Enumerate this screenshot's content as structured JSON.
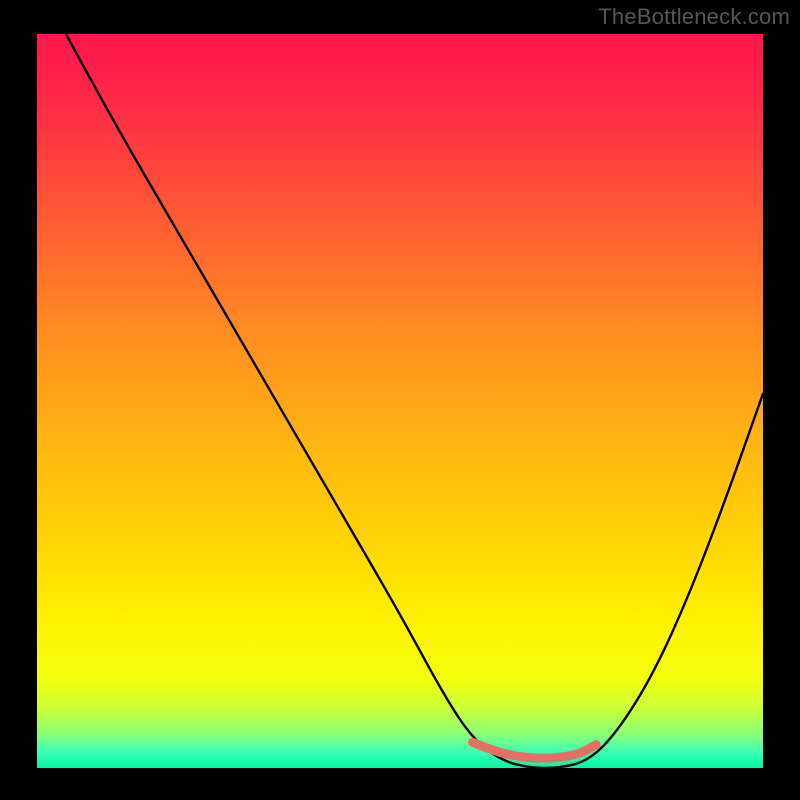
{
  "watermark": "TheBottleneck.com",
  "colors": {
    "black": "#000000",
    "gradient_stops": [
      {
        "offset": 0.0,
        "color": "#ff154e"
      },
      {
        "offset": 0.1,
        "color": "#ff2b46"
      },
      {
        "offset": 0.25,
        "color": "#ff5a34"
      },
      {
        "offset": 0.4,
        "color": "#ff8b22"
      },
      {
        "offset": 0.55,
        "color": "#ffb312"
      },
      {
        "offset": 0.7,
        "color": "#ffd704"
      },
      {
        "offset": 0.8,
        "color": "#fff200"
      },
      {
        "offset": 0.88,
        "color": "#f3ff0c"
      },
      {
        "offset": 0.92,
        "color": "#caff3a"
      },
      {
        "offset": 0.955,
        "color": "#87ff7a"
      },
      {
        "offset": 0.978,
        "color": "#3cffb6"
      },
      {
        "offset": 1.0,
        "color": "#00f7a3"
      }
    ],
    "curve": "#000000",
    "segment": "#e47062"
  },
  "chart_data": {
    "type": "line",
    "title": "",
    "xlabel": "",
    "ylabel": "",
    "xlim": [
      0,
      100
    ],
    "ylim": [
      0,
      100
    ],
    "grid": false,
    "legend": false,
    "series": [
      {
        "name": "bottleneck_curve",
        "x": [
          4,
          10,
          20,
          30,
          40,
          50,
          56,
          60,
          64,
          68,
          72,
          76,
          80,
          85,
          90,
          95,
          100
        ],
        "y": [
          100,
          89,
          72,
          55,
          38,
          21,
          10,
          4,
          1,
          0,
          0,
          1,
          5,
          13,
          24,
          37,
          51
        ]
      }
    ],
    "highlight_segment": {
      "name": "sweet_spot",
      "x": [
        60,
        63,
        66,
        69,
        72,
        75,
        77
      ],
      "y": [
        3.5,
        2.3,
        1.6,
        1.3,
        1.4,
        2.0,
        3.2
      ]
    },
    "notes": "y is plotted inverted visually (0 at bottom = best / green). Curve minimum ≈ x 68–72."
  }
}
